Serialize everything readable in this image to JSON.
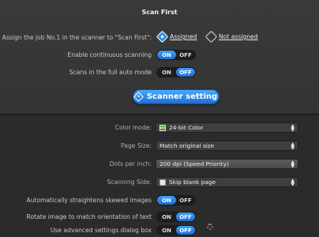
{
  "title": "Scan First",
  "job": {
    "label": "Assign the job No.1 in the scanner to \"Scan First\":",
    "assigned": "Assigned",
    "not_assigned": "Not assigned",
    "selected": "assigned"
  },
  "toggles": {
    "on": "ON",
    "off": "OFF",
    "continuous": {
      "label": "Enable continuous scanning",
      "value": "ON"
    },
    "full_auto": {
      "label": "Scans in the full auto mode",
      "value": "OFF"
    },
    "straighten": {
      "label": "Automatically straightens skewed images",
      "value": "ON"
    },
    "rotate": {
      "label": "Rotate image to match orientation of text",
      "value": "OFF"
    },
    "advanced": {
      "label": "Use advanced settings dialog box",
      "value": "OFF"
    }
  },
  "scanner_setting_button": "Scanner setting",
  "settings": {
    "color_mode": {
      "label": "Color mode:",
      "value": "24-bit Color",
      "icon": "color-icon"
    },
    "page_size": {
      "label": "Page Size:",
      "value": "Match original size"
    },
    "dpi": {
      "label": "Dots per inch:",
      "value": "200 dpi (Speed Priority)"
    },
    "scanning_side": {
      "label": "Scanning Side:",
      "value": "Skip blank page",
      "icon": "page-icon"
    }
  }
}
